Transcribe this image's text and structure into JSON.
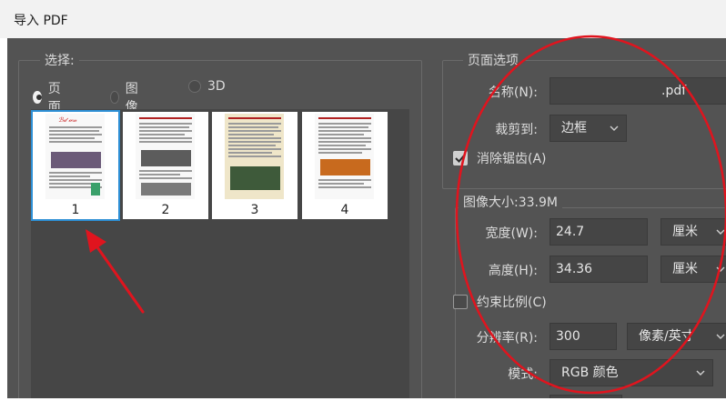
{
  "window": {
    "title": "导入 PDF"
  },
  "select_group": {
    "legend": "选择:",
    "radios": [
      {
        "label": "页面",
        "selected": true
      },
      {
        "label": "图像",
        "selected": false
      },
      {
        "label": "3D",
        "selected": false
      }
    ],
    "thumbnails": [
      {
        "number": "1",
        "selected": true
      },
      {
        "number": "2",
        "selected": false
      },
      {
        "number": "3",
        "selected": false
      },
      {
        "number": "4",
        "selected": false
      }
    ]
  },
  "page_options": {
    "legend": "页面选项",
    "name_label": "名称(N):",
    "name_value": ".pdf",
    "crop_label": "裁剪到:",
    "crop_value": "边框",
    "antialias_label": "消除锯齿(A)",
    "antialias_checked": true
  },
  "image_size": {
    "legend": "图像大小:33.9M",
    "width_label": "宽度(W):",
    "width_value": "24.7",
    "width_unit": "厘米",
    "height_label": "高度(H):",
    "height_value": "34.36",
    "height_unit": "厘米",
    "constrain_label": "约束比例(C)",
    "constrain_checked": false,
    "resolution_label": "分辨率(R):",
    "resolution_value": "300",
    "resolution_unit": "像素/英寸",
    "mode_label": "模式:",
    "mode_value": "RGB 颜色"
  },
  "colors": {
    "annotation_red": "#e0141e",
    "selection_blue": "#2d8fd5",
    "dialog_bg": "#535353"
  }
}
